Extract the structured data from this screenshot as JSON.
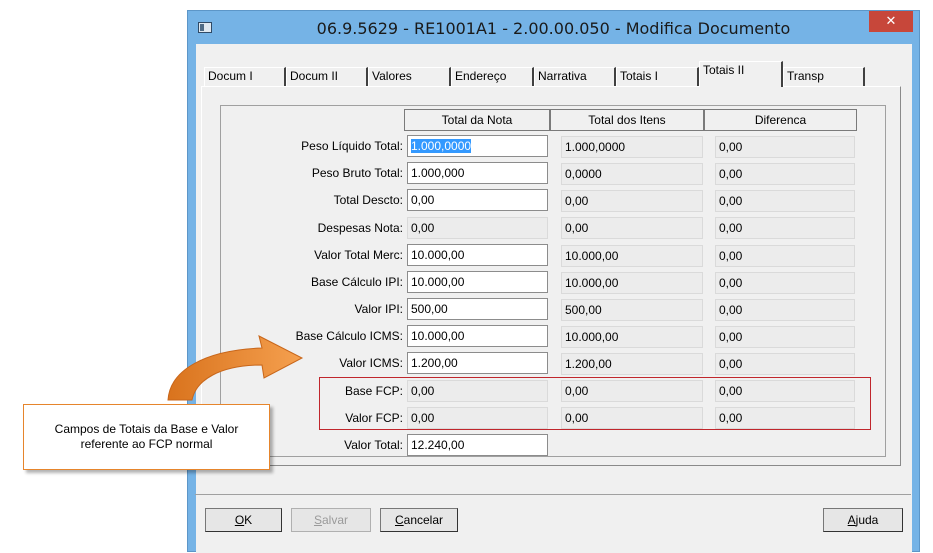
{
  "window": {
    "title": "06.9.5629 - RE1001A1 - 2.00.00.050 - Modifica Documento",
    "close_glyph": "✕"
  },
  "tabs": [
    "Docum I",
    "Docum II",
    "Valores",
    "Endereço",
    "Narrativa",
    "Totais I",
    "Totais II",
    "Transp"
  ],
  "active_tab": "Totais II",
  "columns": [
    "Total da Nota",
    "Total dos Itens",
    "Diferenca"
  ],
  "rows": [
    {
      "label": "Peso Líquido Total:",
      "nota": "1.000,0000",
      "itens": "1.000,0000",
      "diferenca": "0,00"
    },
    {
      "label": "Peso Bruto Total:",
      "nota": "1.000,000",
      "itens": "0,0000",
      "diferenca": "0,00"
    },
    {
      "label": "Total Descto:",
      "nota": "0,00",
      "itens": "0,00",
      "diferenca": "0,00"
    },
    {
      "label": "Despesas Nota:",
      "nota": "0,00",
      "itens": "0,00",
      "diferenca": "0,00"
    },
    {
      "label": "Valor Total Merc:",
      "nota": "10.000,00",
      "itens": "10.000,00",
      "diferenca": "0,00"
    },
    {
      "label": "Base Cálculo IPI:",
      "nota": "10.000,00",
      "itens": "10.000,00",
      "diferenca": "0,00"
    },
    {
      "label": "Valor IPI:",
      "nota": "500,00",
      "itens": "500,00",
      "diferenca": "0,00"
    },
    {
      "label": "Base Cálculo ICMS:",
      "nota": "10.000,00",
      "itens": "10.000,00",
      "diferenca": "0,00"
    },
    {
      "label": "Valor ICMS:",
      "nota": "1.200,00",
      "itens": "1.200,00",
      "diferenca": "0,00"
    },
    {
      "label": "Base FCP:",
      "nota": "0,00",
      "itens": "0,00",
      "diferenca": "0,00"
    },
    {
      "label": "Valor FCP:",
      "nota": "0,00",
      "itens": "0,00",
      "diferenca": "0,00"
    },
    {
      "label": "Valor Total:",
      "nota": "12.240,00"
    }
  ],
  "buttons": {
    "ok": {
      "mnemonic": "O",
      "rest": "K"
    },
    "salvar": {
      "mnemonic": "S",
      "rest": "alvar"
    },
    "cancelar": {
      "mnemonic": "C",
      "rest": "ancelar"
    },
    "ajuda": {
      "mnemonic": "A",
      "rest": "juda"
    }
  },
  "callout": {
    "text": "Campos de Totais da Base e Valor referente ao FCP normal"
  },
  "colors": {
    "window_frame": "#75b3e6",
    "close_button": "#c7473a",
    "highlight_box": "#c0262c",
    "callout_arrow": "#e6852c",
    "selection": "#3399ff"
  }
}
